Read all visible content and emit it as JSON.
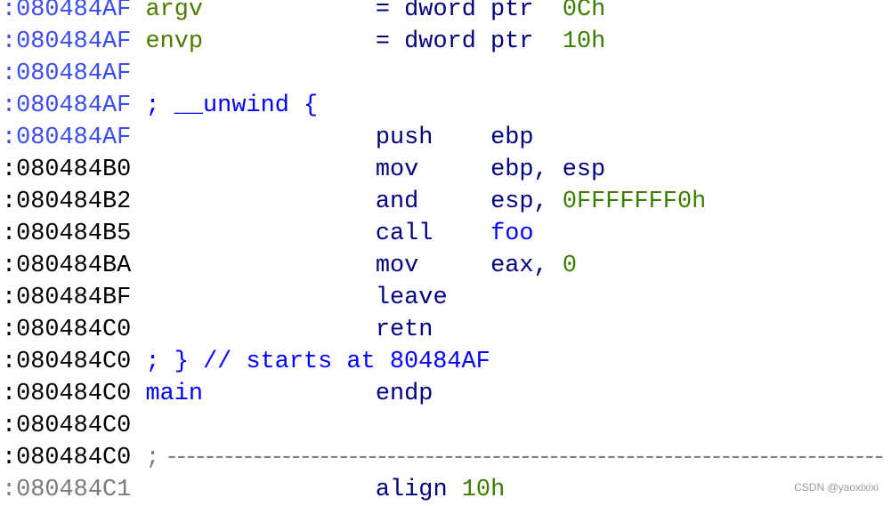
{
  "colors": {
    "address_func": "#3a4cf0",
    "address_code": "#000000",
    "address_data": "#7a7a7a",
    "name": "#4a7a00",
    "mnemonic": "#000080",
    "number": "#3c7d00",
    "comment": "#0000ff"
  },
  "lines": [
    {
      "addr": ":080484AF",
      "ac": "addr-blue",
      "segs": [
        {
          "t": "argv",
          "c": "name",
          "col": 10
        },
        {
          "t": "= dword ptr",
          "c": "op",
          "col": 26
        },
        {
          "t": "0Ch",
          "c": "num",
          "col": 39
        }
      ]
    },
    {
      "addr": ":080484AF",
      "ac": "addr-blue",
      "segs": [
        {
          "t": "envp",
          "c": "name",
          "col": 10
        },
        {
          "t": "= dword ptr",
          "c": "op",
          "col": 26
        },
        {
          "t": "10h",
          "c": "num",
          "col": 39
        }
      ]
    },
    {
      "addr": ":080484AF",
      "ac": "addr-blue",
      "segs": []
    },
    {
      "addr": ":080484AF",
      "ac": "addr-blue",
      "segs": [
        {
          "t": "; __unwind {",
          "c": "cmt",
          "col": 10
        }
      ]
    },
    {
      "addr": ":080484AF",
      "ac": "addr-blue",
      "segs": [
        {
          "t": "push",
          "c": "mn",
          "col": 26
        },
        {
          "t": "ebp",
          "c": "op",
          "col": 34
        }
      ]
    },
    {
      "addr": ":080484B0",
      "ac": "addr-black",
      "segs": [
        {
          "t": "mov",
          "c": "mn",
          "col": 26
        },
        {
          "t": "ebp, esp",
          "c": "op",
          "col": 34
        }
      ]
    },
    {
      "addr": ":080484B2",
      "ac": "addr-black",
      "segs": [
        {
          "t": "and",
          "c": "mn",
          "col": 26
        },
        {
          "t": "esp,",
          "c": "op",
          "col": 34
        },
        {
          "t": "0FFFFFFF0h",
          "c": "num",
          "col": 39
        }
      ]
    },
    {
      "addr": ":080484B5",
      "ac": "addr-black",
      "segs": [
        {
          "t": "call",
          "c": "mn",
          "col": 26
        },
        {
          "t": "foo",
          "c": "ref",
          "col": 34
        }
      ]
    },
    {
      "addr": ":080484BA",
      "ac": "addr-black",
      "segs": [
        {
          "t": "mov",
          "c": "mn",
          "col": 26
        },
        {
          "t": "eax,",
          "c": "op",
          "col": 34
        },
        {
          "t": "0",
          "c": "num",
          "col": 39
        }
      ]
    },
    {
      "addr": ":080484BF",
      "ac": "addr-black",
      "segs": [
        {
          "t": "leave",
          "c": "mn",
          "col": 26
        }
      ]
    },
    {
      "addr": ":080484C0",
      "ac": "addr-black",
      "segs": [
        {
          "t": "retn",
          "c": "mn",
          "col": 26
        }
      ]
    },
    {
      "addr": ":080484C0",
      "ac": "addr-black",
      "segs": [
        {
          "t": "; } // starts at 80484AF",
          "c": "cmt",
          "col": 10
        }
      ]
    },
    {
      "addr": ":080484C0",
      "ac": "addr-black",
      "segs": [
        {
          "t": "main",
          "c": "ref",
          "col": 10
        },
        {
          "t": "endp",
          "c": "mn",
          "col": 26
        }
      ]
    },
    {
      "addr": ":080484C0",
      "ac": "addr-black",
      "segs": []
    },
    {
      "addr": ":080484C0",
      "ac": "addr-black",
      "segs": [
        {
          "t": "; ---------------------------------------------------------------------------",
          "c": "sep",
          "col": 10
        }
      ]
    },
    {
      "addr": ":080484C1",
      "ac": "addr-gray",
      "segs": [
        {
          "t": "align",
          "c": "mn",
          "col": 26
        },
        {
          "t": "10h",
          "c": "num",
          "col": 32
        }
      ]
    }
  ],
  "watermark": "CSDN @yaoxixixi"
}
